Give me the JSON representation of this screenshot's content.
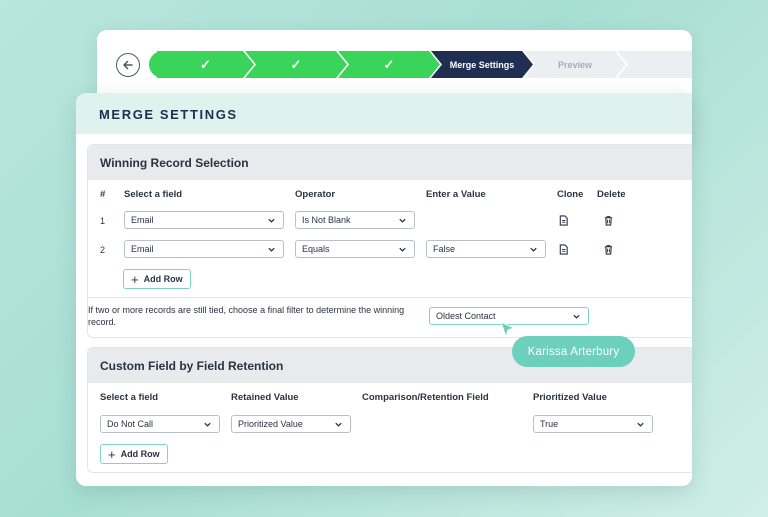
{
  "wizard": {
    "steps": [
      {
        "state": "done",
        "label": "✓"
      },
      {
        "state": "done",
        "label": "✓"
      },
      {
        "state": "done",
        "label": "✓"
      },
      {
        "state": "active",
        "label": "Merge Settings"
      },
      {
        "state": "pending",
        "label": "Preview"
      }
    ]
  },
  "main": {
    "title": "MERGE SETTINGS"
  },
  "winning": {
    "title": "Winning Record Selection",
    "headers": {
      "num": "#",
      "field": "Select a field",
      "operator": "Operator",
      "value": "Enter a Value",
      "clone": "Clone",
      "delete": "Delete"
    },
    "rows": [
      {
        "num": "1",
        "field": "Email",
        "operator": "Is Not Blank",
        "value": ""
      },
      {
        "num": "2",
        "field": "Email",
        "operator": "Equals",
        "value": "False"
      }
    ],
    "add_row": "Add Row",
    "tie_text": "If two or more records are still tied, choose a final filter to determine the winning record.",
    "tie_value": "Oldest Contact"
  },
  "tooltip": {
    "name": "Karissa Arterbury"
  },
  "retention": {
    "title": "Custom Field by Field Retention",
    "headers": {
      "field": "Select a field",
      "retained": "Retained Value",
      "comparison": "Comparison/Retention Field",
      "prioritized": "Prioritized Value"
    },
    "row": {
      "field": "Do Not Call",
      "retained": "Prioritized Value",
      "prioritized": "True"
    },
    "add_row": "Add Row"
  },
  "colors": {
    "done": "#3bd45a",
    "active": "#1f2f52",
    "accent": "#6dd0bc"
  }
}
